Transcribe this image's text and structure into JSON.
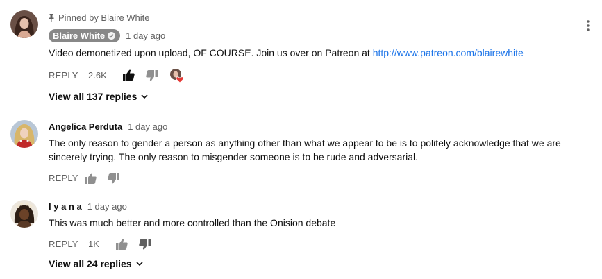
{
  "comments": [
    {
      "pinned_label": "Pinned by Blaire White",
      "author": "Blaire White",
      "time": "1 day ago",
      "text_prefix": "Video demonetized upon upload, OF COURSE. Join us over on Patreon at ",
      "link": "http://www.patreon.com/blairewhite",
      "reply_label": "REPLY",
      "likes": "2.6K",
      "view_replies": "View all 137 replies",
      "icons": [
        "pin-icon",
        "verified-check-icon",
        "thumbs-up-icon",
        "thumbs-down-icon",
        "creator-heart-icon",
        "more-vert-icon",
        "chevron-down-icon"
      ]
    },
    {
      "author": "Angelica Perduta",
      "time": "1 day ago",
      "text": "The only reason to gender a person as anything other than what we appear to be is to politely acknowledge that we are sincerely trying. The only reason to misgender someone is to be rude and adversarial.",
      "reply_label": "REPLY"
    },
    {
      "author": "I y a n a",
      "time": "1 day ago",
      "text": "This was much better and more controlled than the Onision debate",
      "reply_label": "REPLY",
      "likes": "1K",
      "view_replies": "View all 24 replies"
    }
  ],
  "colors": {
    "link": "#1a73e8",
    "secondary_text": "#606060",
    "author_chip": "#888888",
    "heart": "#e53935"
  }
}
